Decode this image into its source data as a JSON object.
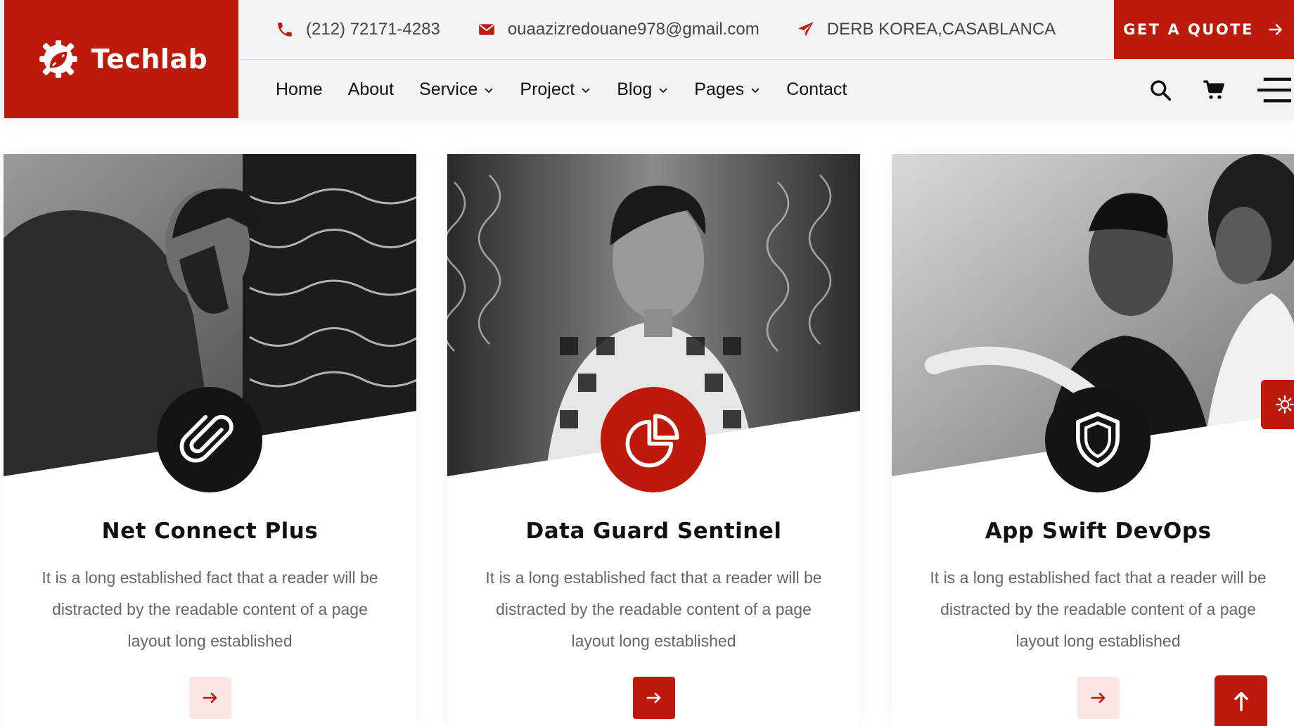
{
  "brand": {
    "name": "Techlab",
    "logo_icon": "gear-leaf-icon",
    "color": "#bd1a0b"
  },
  "contact": {
    "phone": "(212) 72171-4283",
    "email": "ouaazizredouane978@gmail.com",
    "address": "DERB KOREA,CASABLANCA"
  },
  "quote_button": {
    "label": "GET A QUOTE"
  },
  "nav": {
    "items": [
      {
        "label": "Home",
        "dropdown": false
      },
      {
        "label": "About",
        "dropdown": false
      },
      {
        "label": "Service",
        "dropdown": true
      },
      {
        "label": "Project",
        "dropdown": true
      },
      {
        "label": "Blog",
        "dropdown": true
      },
      {
        "label": "Pages",
        "dropdown": true
      },
      {
        "label": "Contact",
        "dropdown": false
      }
    ]
  },
  "header_icons": [
    "search-icon",
    "cart-icon",
    "menu-icon"
  ],
  "cards": [
    {
      "title": "Net Connect Plus",
      "description": "It is a long established fact that a reader will be distracted by the readable content of a page layout long established",
      "icon": "paperclip-icon",
      "icon_style": "dark",
      "button_style": "light"
    },
    {
      "title": "Data Guard Sentinel",
      "description": "It is a long established fact that a reader will be distracted by the readable content of a page layout long established",
      "icon": "pie-chart-icon",
      "icon_style": "red",
      "button_style": "solid"
    },
    {
      "title": "App Swift DevOps",
      "description": "It is a long established fact that a reader will be distracted by the readable content of a page layout long established",
      "icon": "shield-icon",
      "icon_style": "dark",
      "button_style": "light"
    }
  ]
}
